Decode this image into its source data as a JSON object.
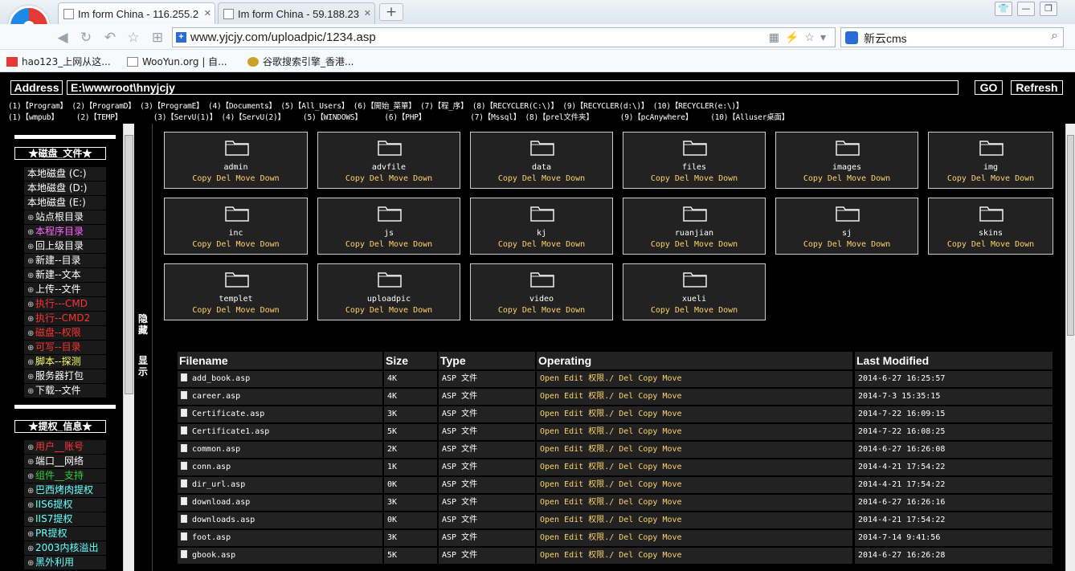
{
  "browser": {
    "tabs": [
      {
        "title": "Im form China - 116.255.2"
      },
      {
        "title": "Im form China - 59.188.23"
      }
    ],
    "new_tab": "+",
    "url": "www.yjcjy.com/uploadpic/1234.asp",
    "search_text": "新云cms",
    "bookmarks": [
      {
        "label": "hao123_上网从这..."
      },
      {
        "label": "WooYun.org | 自..."
      },
      {
        "label": "谷歌搜索引擎_香港..."
      }
    ]
  },
  "shell": {
    "address_label": "Address",
    "path": "E:\\wwwroot\\hnyjcjy",
    "go_label": "GO",
    "refresh_label": "Refresh",
    "quick_row1": "(1)【Program】 (2)【ProgramD】 (3)【ProgramE】 (4)【Documents】 (5)【All_Users】 (6)【開始_菜單】 (7)【程_序】 (8)【RECYCLER(C:\\)】 (9)【RECYCLER(d:\\)】 (10)【RECYCLER(e:\\)】",
    "quick_row2": "(1)【wmpub】    (2)【TEMP】       (3)【ServU(1)】 (4)【ServU(2)】    (5)【WINDOWS】     (6)【PHP】          (7)【Mssql】 (8)【prel文件夹】      (9)【pcAnywhere】    (10)【Alluser桌面】",
    "toggle_hide": "隐藏",
    "toggle_show": "显示"
  },
  "sidebar": {
    "section1": "★磁盘_文件★",
    "disks": [
      "本地磁盘 (C:)",
      "本地磁盘 (D:)",
      "本地磁盘 (E:)"
    ],
    "items1": [
      {
        "label": "站点根目录",
        "color": "#ffffff"
      },
      {
        "label": "本程序目录",
        "color": "#ff66ff"
      },
      {
        "label": "回上级目录",
        "color": "#ffffff"
      },
      {
        "label": "新建--目录",
        "color": "#ffffff"
      },
      {
        "label": "新建--文本",
        "color": "#ffffff"
      },
      {
        "label": "上传--文件",
        "color": "#ffffff"
      },
      {
        "label": "执行---CMD",
        "color": "#ff3333"
      },
      {
        "label": "执行--CMD2",
        "color": "#ff3333"
      },
      {
        "label": "磁盘--权限",
        "color": "#ff3333"
      },
      {
        "label": "可写--目录",
        "color": "#ff3333"
      },
      {
        "label": "脚本--探测",
        "color": "#ffff66"
      },
      {
        "label": "服务器打包",
        "color": "#ffffff"
      },
      {
        "label": "下载--文件",
        "color": "#ffffff"
      }
    ],
    "section2": "★提权_信息★",
    "items2": [
      {
        "label": "用户__账号",
        "color": "#ff3333"
      },
      {
        "label": "端口__网络",
        "color": "#ffffff"
      },
      {
        "label": "组件__支持",
        "color": "#33cc33"
      },
      {
        "label": "巴西烤肉提权",
        "color": "#66ffff"
      },
      {
        "label": "IIS6提权",
        "color": "#66ffff"
      },
      {
        "label": "IIS7提权",
        "color": "#66ffff"
      },
      {
        "label": "PR提权",
        "color": "#66ffff"
      },
      {
        "label": "2003内核溢出",
        "color": "#66ffff"
      },
      {
        "label": "黑外利用",
        "color": "#66ffff"
      }
    ]
  },
  "folders": [
    {
      "name": "admin",
      "ops": "Copy Del Move Down"
    },
    {
      "name": "advfile",
      "ops": "Copy Del Move Down"
    },
    {
      "name": "data",
      "ops": "Copy Del Move Down"
    },
    {
      "name": "files",
      "ops": "Copy Del Move Down"
    },
    {
      "name": "images",
      "ops": "Copy Del Move Down"
    },
    {
      "name": "img",
      "ops": "Copy Del Move Down"
    },
    {
      "name": "inc",
      "ops": "Copy Del Move Down"
    },
    {
      "name": "js",
      "ops": "Copy Del Move Down"
    },
    {
      "name": "kj",
      "ops": "Copy Del Move Down"
    },
    {
      "name": "ruanjian",
      "ops": "Copy Del Move Down"
    },
    {
      "name": "sj",
      "ops": "Copy Del Move Down"
    },
    {
      "name": "skins",
      "ops": "Copy Del Move Down"
    },
    {
      "name": "templet",
      "ops": "Copy Del Move Down"
    },
    {
      "name": "uploadpic",
      "ops": "Copy Del Move Down"
    },
    {
      "name": "video",
      "ops": "Copy Del Move Down"
    },
    {
      "name": "xueli",
      "ops": "Copy Del Move Down"
    }
  ],
  "table": {
    "headers": [
      "Filename",
      "Size",
      "Type",
      "Operating",
      "Last Modified"
    ],
    "ops": "Open Edit 权限./ Del Copy Move",
    "rows": [
      {
        "name": "add_book.asp",
        "size": "4K",
        "type": "ASP 文件",
        "modified": "2014-6-27 16:25:57"
      },
      {
        "name": "career.asp",
        "size": "4K",
        "type": "ASP 文件",
        "modified": "2014-7-3 15:35:15"
      },
      {
        "name": "Certificate.asp",
        "size": "3K",
        "type": "ASP 文件",
        "modified": "2014-7-22 16:09:15"
      },
      {
        "name": "Certificate1.asp",
        "size": "5K",
        "type": "ASP 文件",
        "modified": "2014-7-22 16:08:25"
      },
      {
        "name": "common.asp",
        "size": "2K",
        "type": "ASP 文件",
        "modified": "2014-6-27 16:26:08"
      },
      {
        "name": "conn.asp",
        "size": "1K",
        "type": "ASP 文件",
        "modified": "2014-4-21 17:54:22"
      },
      {
        "name": "dir_url.asp",
        "size": "0K",
        "type": "ASP 文件",
        "modified": "2014-4-21 17:54:22"
      },
      {
        "name": "download.asp",
        "size": "3K",
        "type": "ASP 文件",
        "modified": "2014-6-27 16:26:16"
      },
      {
        "name": "downloads.asp",
        "size": "0K",
        "type": "ASP 文件",
        "modified": "2014-4-21 17:54:22"
      },
      {
        "name": "foot.asp",
        "size": "3K",
        "type": "ASP 文件",
        "modified": "2014-7-14 9:41:56"
      },
      {
        "name": "gbook.asp",
        "size": "5K",
        "type": "ASP 文件",
        "modified": "2014-6-27 16:26:28"
      }
    ]
  }
}
